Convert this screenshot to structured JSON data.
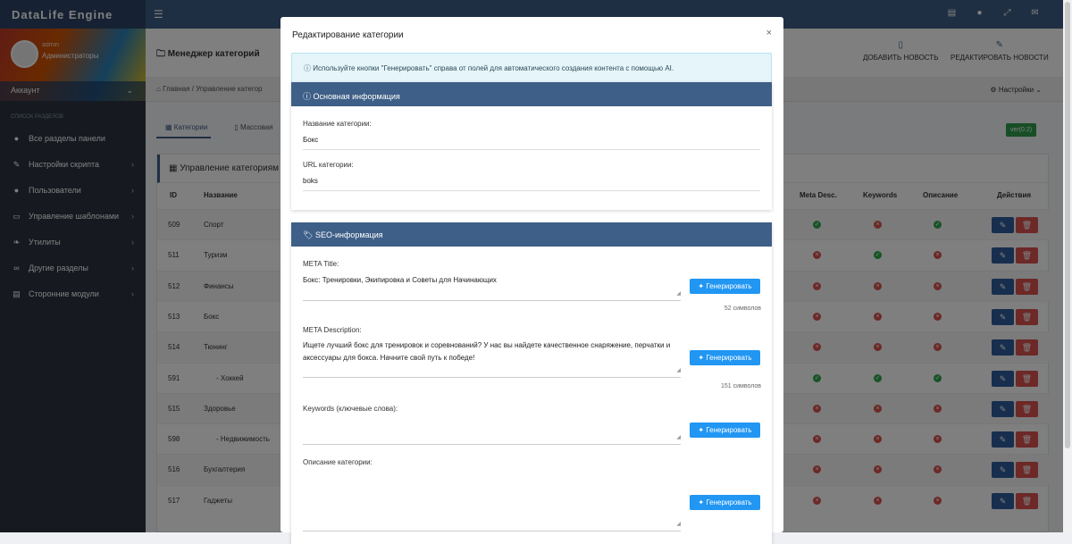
{
  "app": {
    "brand": "DataLife Engine"
  },
  "topbar": {
    "icons": [
      "news-icon",
      "globe-icon",
      "expand-icon",
      "mail-icon"
    ]
  },
  "sidebar": {
    "user": {
      "name": "admin",
      "role": "Администраторы"
    },
    "account": "Аккаунт",
    "section_title": "Список разделов",
    "items": [
      {
        "label": "Все разделы панели",
        "icon": "globe-icon",
        "arrow": ""
      },
      {
        "label": "Настройки скрипта",
        "icon": "wrench-icon",
        "arrow": "›"
      },
      {
        "label": "Пользователи",
        "icon": "user-icon",
        "arrow": "›"
      },
      {
        "label": "Управление шаблонами",
        "icon": "laptop-icon",
        "arrow": "›"
      },
      {
        "label": "Утилиты",
        "icon": "leaf-icon",
        "arrow": "›"
      },
      {
        "label": "Другие разделы",
        "icon": "link-icon",
        "arrow": "›"
      },
      {
        "label": "Сторонние модули",
        "icon": "modules-icon",
        "arrow": "›"
      }
    ]
  },
  "page": {
    "title": "Менеджер категорий",
    "add_news": "ДОБАВИТЬ НОВОСТЬ",
    "edit_news": "РЕДАКТИРОВАТЬ НОВОСТИ",
    "breadcrumb_home": "Главная",
    "breadcrumb_current": "Управление категор",
    "settings": "Настройки",
    "tabs": [
      "Категории",
      "Массовая"
    ],
    "version": "ver(0.2)",
    "panel_title": "Управление категориям",
    "columns": {
      "id": "ID",
      "name": "Название",
      "meta_desc": "Meta Desc.",
      "keywords": "Keywords",
      "description": "Описание",
      "actions": "Действия"
    },
    "rows": [
      {
        "id": "509",
        "name": "Спорт",
        "meta": "ok",
        "kw": "no",
        "desc": "ok"
      },
      {
        "id": "511",
        "name": "Туризм",
        "meta": "no",
        "kw": "ok",
        "desc": "no"
      },
      {
        "id": "512",
        "name": "Финансы",
        "meta": "no",
        "kw": "no",
        "desc": "no"
      },
      {
        "id": "513",
        "name": "Бокс",
        "meta": "no",
        "kw": "no",
        "desc": "no"
      },
      {
        "id": "514",
        "name": "Тюнинг",
        "meta": "no",
        "kw": "no",
        "desc": "no"
      },
      {
        "id": "591",
        "name": "- Хоккей",
        "meta": "ok",
        "kw": "ok",
        "desc": "ok"
      },
      {
        "id": "515",
        "name": "Здоровье",
        "meta": "no",
        "kw": "no",
        "desc": "no"
      },
      {
        "id": "598",
        "name": "- Недвижимость",
        "meta": "no",
        "kw": "no",
        "desc": "no"
      },
      {
        "id": "516",
        "name": "Бухгалтерия",
        "meta": "no",
        "kw": "no",
        "desc": "no"
      },
      {
        "id": "517",
        "name": "Гаджеты",
        "meta": "no",
        "kw": "no",
        "desc": "no"
      }
    ]
  },
  "modal": {
    "title": "Редактирование категории",
    "close": "×",
    "info": "Используйте кнопки \"Генерировать\" справа от полей для автоматического создания контента с помощью AI.",
    "basic_title": "Основная информация",
    "name_label": "Название категории:",
    "name_value": "Бокс",
    "url_label": "URL категории:",
    "url_value": "boks",
    "seo_title": "SEO-информация",
    "meta_title_label": "META Title:",
    "meta_title_value": "Бокс: Тренировки, Экипировка и Советы для Начинающих",
    "meta_title_count": "52 символов",
    "meta_desc_label": "META Description:",
    "meta_desc_value": "Ищете лучший бокс для тренировок и соревнований? У нас вы найдете качественное снаряжение, перчатки и аксессуары для бокса. Начните свой путь к победе!",
    "meta_desc_count": "151 символов",
    "keywords_label": "Keywords (ключевые слова):",
    "desc_label": "Описание категории:",
    "generate": "Генерировать"
  }
}
